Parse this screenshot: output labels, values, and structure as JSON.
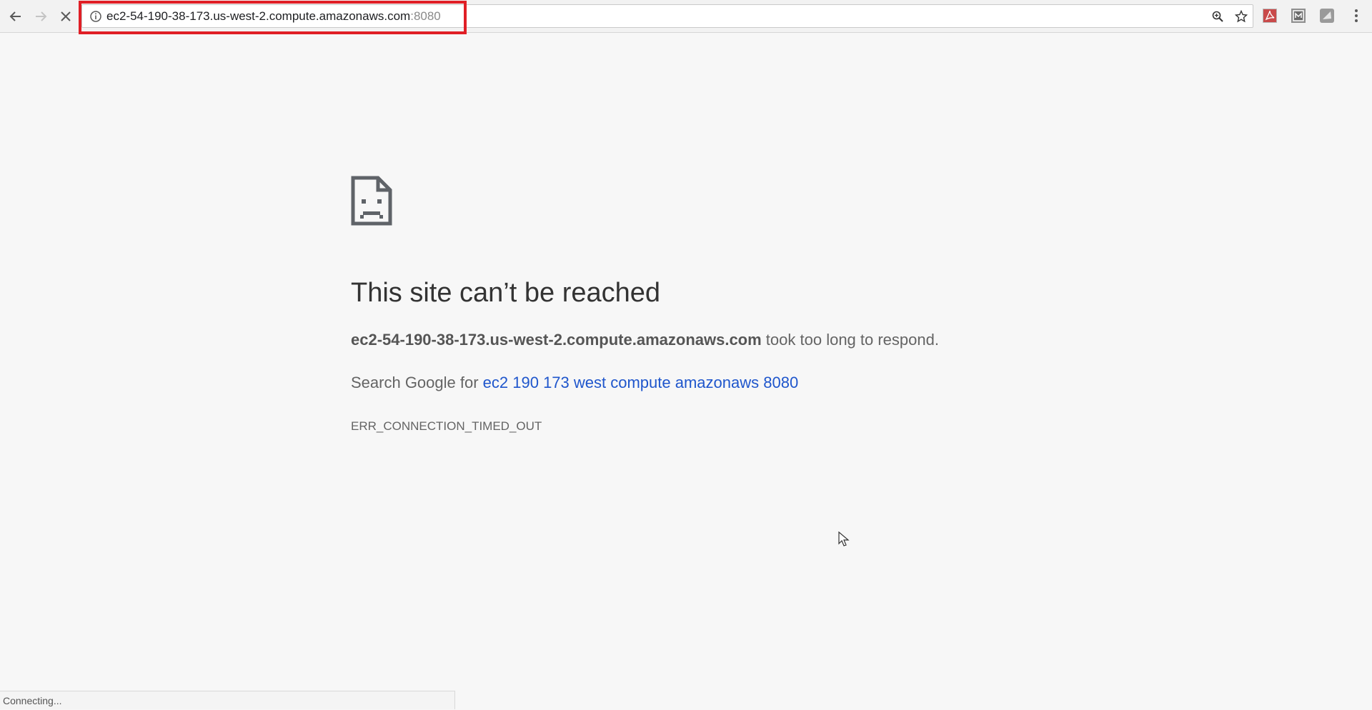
{
  "browser": {
    "url_host": "ec2-54-190-38-173.us-west-2.compute.amazonaws.com",
    "url_port": ":8080",
    "toolbar_icons": {
      "back": "back-arrow-icon",
      "forward": "forward-arrow-icon",
      "stop": "stop-x-icon",
      "site_info": "info-icon",
      "zoom": "zoom-icon",
      "bookmark": "star-icon",
      "extensions": [
        "pdf-extension-icon",
        "extension-icon",
        "extension-icon"
      ],
      "menu": "kebab-menu-icon"
    },
    "highlight_color": "#e01f26"
  },
  "error_page": {
    "icon": "sad-document-icon",
    "title": "This site can’t be reached",
    "host_bold": "ec2-54-190-38-173.us-west-2.compute.amazonaws.com",
    "desc_rest": " took too long to respond.",
    "search_prefix": "Search Google for ",
    "search_link": "ec2 190 173 west compute amazonaws 8080",
    "error_code": "ERR_CONNECTION_TIMED_OUT",
    "link_color": "#1f56cc"
  },
  "status": {
    "text": "Connecting..."
  }
}
